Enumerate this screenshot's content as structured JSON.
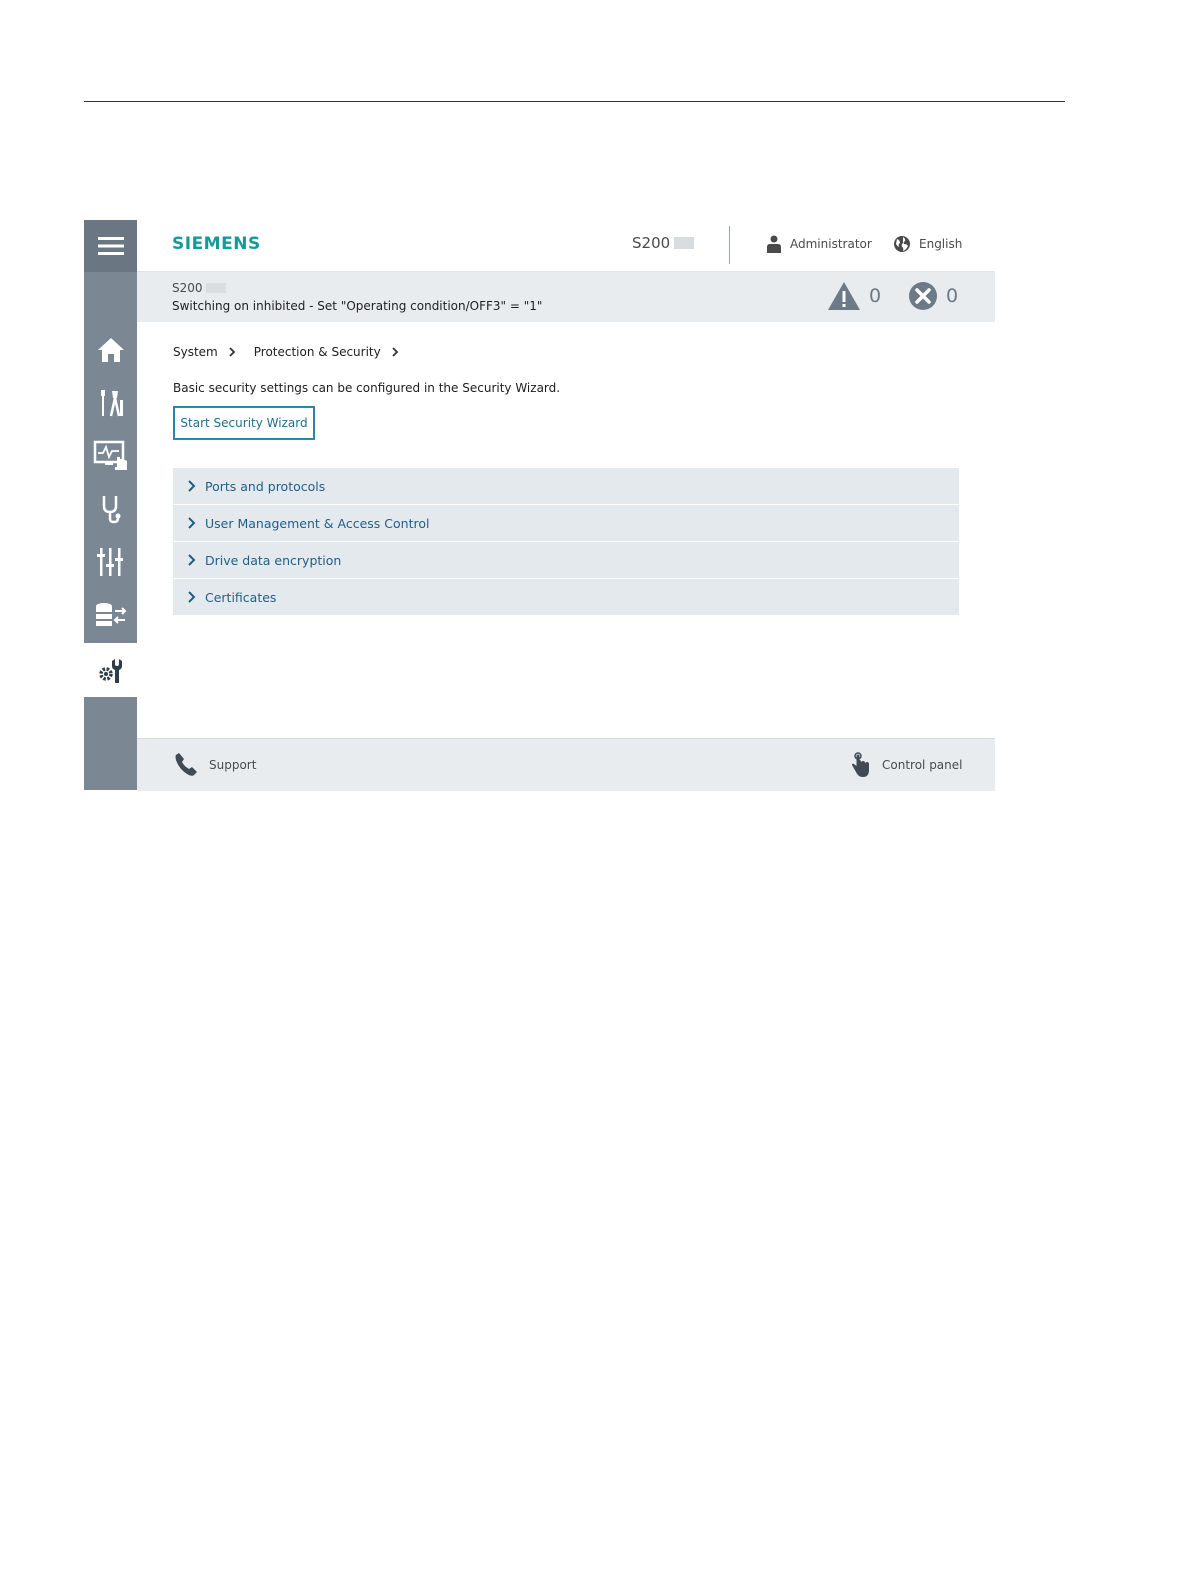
{
  "header": {
    "logo": "SIEMENS",
    "device_name": "S200",
    "user": "Administrator",
    "language": "English"
  },
  "status": {
    "device_name": "S200",
    "message": "Switching on inhibited - Set \"Operating condition/OFF3\" = \"1\"",
    "warning_count": "0",
    "error_count": "0"
  },
  "sidebar": {
    "items": [
      {
        "icon": "home-icon"
      },
      {
        "icon": "tools-icon"
      },
      {
        "icon": "monitor-touch-icon"
      },
      {
        "icon": "stethoscope-icon"
      },
      {
        "icon": "sliders-icon"
      },
      {
        "icon": "database-transfer-icon"
      },
      {
        "icon": "gear-wrench-icon",
        "active": true
      }
    ]
  },
  "breadcrumb": [
    "System",
    "Protection & Security"
  ],
  "main": {
    "intro": "Basic security settings can be configured in the Security Wizard.",
    "wizard_button": "Start Security Wizard",
    "sections": [
      "Ports and protocols",
      "User Management & Access Control",
      "Drive data encryption",
      "Certificates"
    ]
  },
  "footer": {
    "support": "Support",
    "control_panel": "Control panel"
  },
  "colors": {
    "brand": "#139b9b",
    "sidebar": "#7b8894",
    "accent": "#2b86a8",
    "link": "#1f5f86"
  }
}
